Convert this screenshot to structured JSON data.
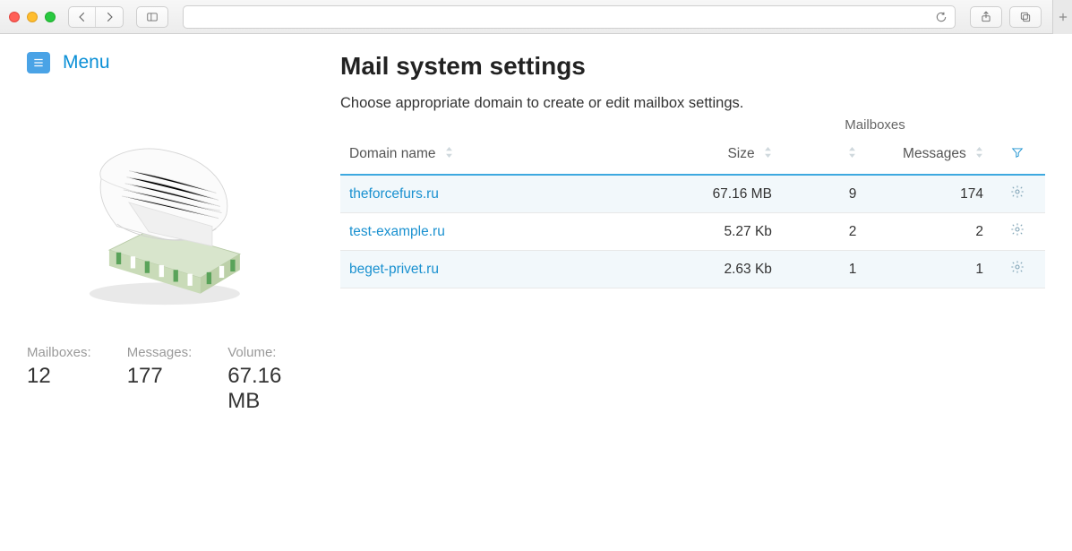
{
  "chrome": {
    "back": "‹",
    "forward": "›"
  },
  "sidebar": {
    "menu_label": "Menu",
    "stats": {
      "mailboxes_label": "Mailboxes:",
      "mailboxes_value": "12",
      "messages_label": "Messages:",
      "messages_value": "177",
      "volume_label": "Volume:",
      "volume_value": "67.16 MB"
    }
  },
  "main": {
    "title": "Mail system settings",
    "subtitle": "Choose appropriate domain to create or edit mailbox settings.",
    "table": {
      "group_header": "Mailboxes",
      "columns": {
        "domain": "Domain name",
        "size": "Size",
        "count": "",
        "messages": "Messages"
      },
      "rows": [
        {
          "domain": "theforcefurs.ru",
          "size": "67.16 MB",
          "count": "9",
          "messages": "174"
        },
        {
          "domain": "test-example.ru",
          "size": "5.27 Kb",
          "count": "2",
          "messages": "2"
        },
        {
          "domain": "beget-privet.ru",
          "size": "2.63 Kb",
          "count": "1",
          "messages": "1"
        }
      ]
    }
  }
}
